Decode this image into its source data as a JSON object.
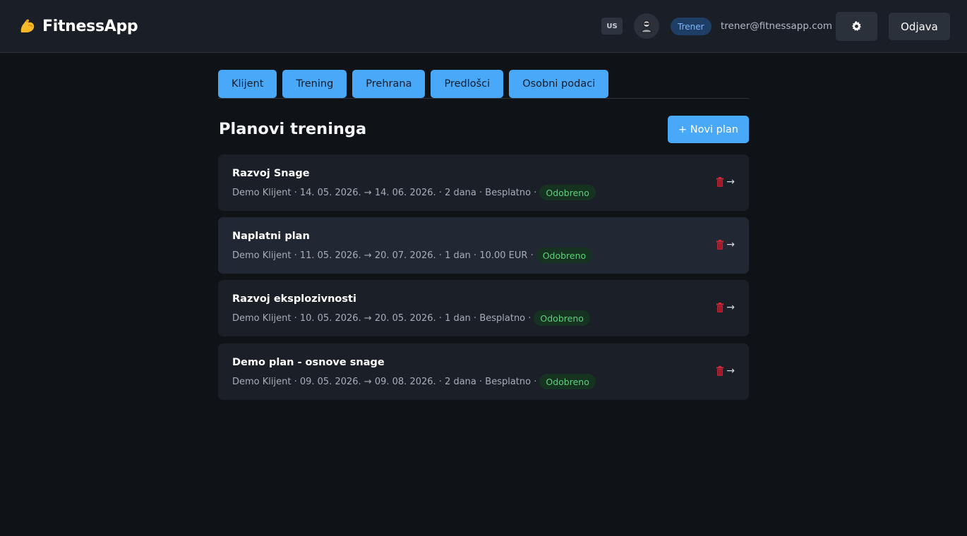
{
  "app": {
    "name": "FitnessApp",
    "logo_icon": "flexed-biceps-icon"
  },
  "header": {
    "language": "US",
    "avatar_icon": "user-avatar-icon",
    "role": "Trener",
    "email": "trener@fitnessapp.com",
    "settings_icon": "gear-icon",
    "logout_label": "Odjava"
  },
  "tabs": [
    {
      "label": "Klijent"
    },
    {
      "label": "Trening"
    },
    {
      "label": "Prehrana"
    },
    {
      "label": "Predlošci"
    },
    {
      "label": "Osobni podaci"
    }
  ],
  "page": {
    "title": "Planovi treninga",
    "new_plan_label": "+ Novi plan"
  },
  "plans": [
    {
      "name": "Razvoj Snage",
      "meta": "Demo Klijent · 14. 05. 2026. → 14. 06. 2026. · 2 dana · Besplatno ·",
      "status": "Odobreno"
    },
    {
      "name": "Naplatni plan",
      "meta": "Demo Klijent · 11. 05. 2026. → 20. 07. 2026. · 1 dan · 10.00 EUR ·",
      "status": "Odobreno"
    },
    {
      "name": "Razvoj eksplozivnosti",
      "meta": "Demo Klijent · 10. 05. 2026. → 20. 05. 2026. · 1 dan · Besplatno ·",
      "status": "Odobreno"
    },
    {
      "name": "Demo plan - osnove snage",
      "meta": "Demo Klijent · 09. 05. 2026. → 09. 08. 2026. · 2 dana · Besplatno ·",
      "status": "Odobreno"
    }
  ],
  "plan_actions": {
    "delete_icon": "trash-icon",
    "open_arrow": "→"
  },
  "colors": {
    "accent": "#4aa8f8",
    "background": "#0f1318",
    "card": "#1b2028",
    "status_green": "#5fd07c",
    "delete_red": "#d0283a"
  }
}
